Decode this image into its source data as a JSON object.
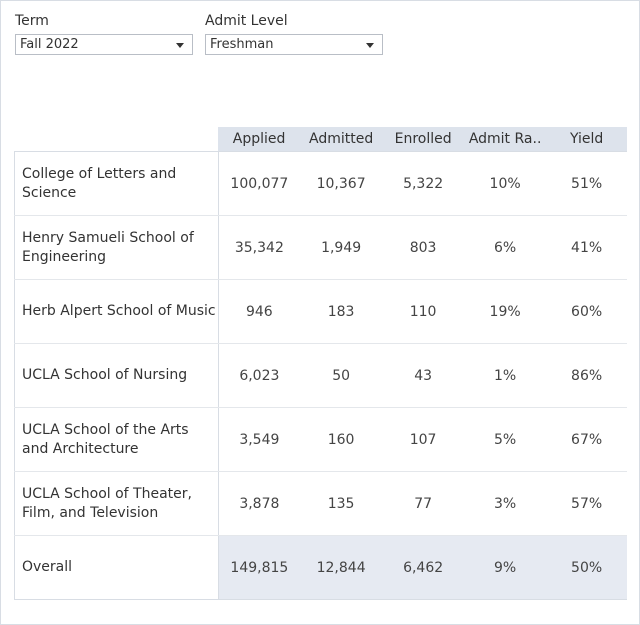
{
  "filters": {
    "term": {
      "label": "Term",
      "value": "Fall 2022"
    },
    "admit_level": {
      "label": "Admit Level",
      "value": "Freshman"
    }
  },
  "table": {
    "columns": [
      "Applied",
      "Admitted",
      "Enrolled",
      "Admit Ra..",
      "Yield"
    ],
    "rows": [
      {
        "name": "College of Letters and Science",
        "values": [
          "100,077",
          "10,367",
          "5,322",
          "10%",
          "51%"
        ]
      },
      {
        "name": "Henry Samueli School of Engineering",
        "values": [
          "35,342",
          "1,949",
          "803",
          "6%",
          "41%"
        ]
      },
      {
        "name": "Herb Alpert School of Music",
        "values": [
          "946",
          "183",
          "110",
          "19%",
          "60%"
        ]
      },
      {
        "name": "UCLA School of Nursing",
        "values": [
          "6,023",
          "50",
          "43",
          "1%",
          "86%"
        ]
      },
      {
        "name": "UCLA School of the Arts and Architecture",
        "values": [
          "3,549",
          "160",
          "107",
          "5%",
          "67%"
        ]
      },
      {
        "name": "UCLA School of Theater, Film, and Television",
        "values": [
          "3,878",
          "135",
          "77",
          "3%",
          "57%"
        ]
      }
    ],
    "overall": {
      "name": "Overall",
      "values": [
        "149,815",
        "12,844",
        "6,462",
        "9%",
        "50%"
      ]
    }
  },
  "colors": {
    "header_bg": "#dde3ec",
    "overall_bg": "#e6eaf2",
    "border": "#d8dde4"
  }
}
